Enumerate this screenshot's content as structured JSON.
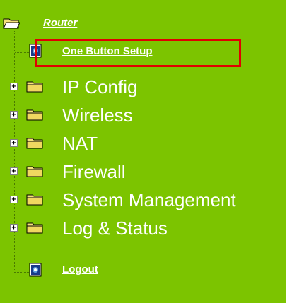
{
  "tree": {
    "root_label": "Router",
    "items": [
      {
        "label": "One Button Setup",
        "type": "page",
        "icon": "page-icon"
      },
      {
        "label": "IP Config",
        "type": "folder",
        "icon": "folder-icon"
      },
      {
        "label": "Wireless",
        "type": "folder",
        "icon": "folder-icon"
      },
      {
        "label": "NAT",
        "type": "folder",
        "icon": "folder-icon"
      },
      {
        "label": "Firewall",
        "type": "folder",
        "icon": "folder-icon"
      },
      {
        "label": "System Management",
        "type": "folder",
        "icon": "folder-icon"
      },
      {
        "label": "Log & Status",
        "type": "folder",
        "icon": "folder-icon"
      },
      {
        "label": "Logout",
        "type": "page",
        "icon": "page-icon"
      }
    ],
    "expand_symbol": "+"
  },
  "colors": {
    "panel_bg": "#7cc400",
    "text": "#ffffff",
    "highlight_border": "#e00000",
    "folder_fill": "#f5e27a"
  }
}
